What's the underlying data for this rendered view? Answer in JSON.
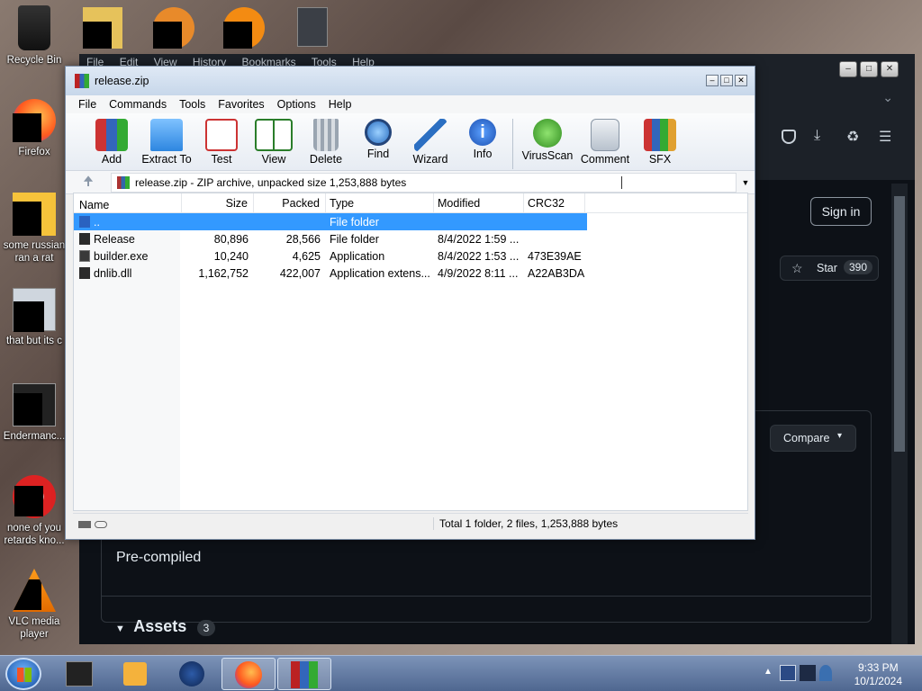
{
  "desktop": {
    "icons": [
      {
        "label": "Recycle Bin"
      },
      {
        "label": "Firefox"
      },
      {
        "label": "some russian ran a rat"
      },
      {
        "label": "that but its c"
      },
      {
        "label": "Endermanc..."
      },
      {
        "label": "none of you retards kno..."
      },
      {
        "label": "VLC media player"
      }
    ]
  },
  "browser": {
    "menu": [
      "File",
      "Edit",
      "View",
      "History",
      "Bookmarks",
      "Tools",
      "Help"
    ],
    "sign_in": "Sign in",
    "star_label": "Star",
    "star_count": "390",
    "compare": "Compare",
    "precompiled": "Pre-compiled",
    "assets_label": "Assets",
    "assets_count": "3",
    "accent": "#0d1117"
  },
  "rar": {
    "title": "release.zip",
    "menu": [
      "File",
      "Commands",
      "Tools",
      "Favorites",
      "Options",
      "Help"
    ],
    "toolbar": [
      "Add",
      "Extract To",
      "Test",
      "View",
      "Delete",
      "Find",
      "Wizard",
      "Info",
      "VirusScan",
      "Comment",
      "SFX"
    ],
    "path": "release.zip - ZIP archive, unpacked size 1,253,888 bytes",
    "columns": [
      "Name",
      "Size",
      "Packed",
      "Type",
      "Modified",
      "CRC32"
    ],
    "rows": [
      {
        "name": "..",
        "size": "",
        "packed": "",
        "type": "File folder",
        "modified": "",
        "crc": ""
      },
      {
        "name": "Release",
        "size": "80,896",
        "packed": "28,566",
        "type": "File folder",
        "modified": "8/4/2022 1:59 ...",
        "crc": ""
      },
      {
        "name": "builder.exe",
        "size": "10,240",
        "packed": "4,625",
        "type": "Application",
        "modified": "8/4/2022 1:53 ...",
        "crc": "473E39AE"
      },
      {
        "name": "dnlib.dll",
        "size": "1,162,752",
        "packed": "422,007",
        "type": "Application extens...",
        "modified": "4/9/2022 8:11 ...",
        "crc": "A22AB3DA"
      }
    ],
    "status": "Total 1 folder, 2 files, 1,253,888 bytes",
    "selection_color": "#3399ff"
  },
  "taskbar": {
    "time": "9:33 PM",
    "date": "10/1/2024"
  }
}
